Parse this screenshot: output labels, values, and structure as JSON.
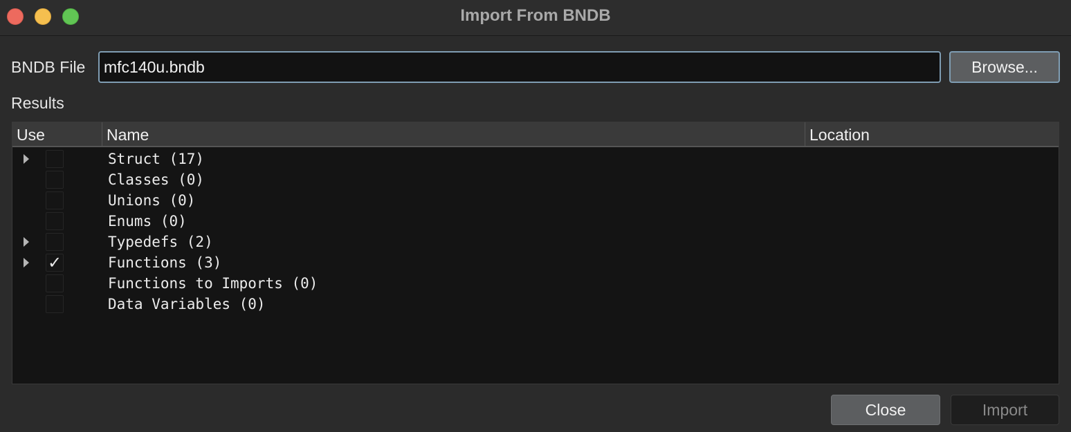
{
  "window": {
    "title": "Import From BNDB"
  },
  "file": {
    "label": "BNDB File",
    "value": "mfc140u.bndb",
    "browse_label": "Browse..."
  },
  "results": {
    "label": "Results",
    "columns": {
      "use": "Use",
      "name": "Name",
      "location": "Location"
    },
    "rows": [
      {
        "name": "Struct (17)",
        "expandable": true,
        "checked": false
      },
      {
        "name": "Classes (0)",
        "expandable": false,
        "checked": false
      },
      {
        "name": "Unions (0)",
        "expandable": false,
        "checked": false
      },
      {
        "name": "Enums (0)",
        "expandable": false,
        "checked": false
      },
      {
        "name": "Typedefs (2)",
        "expandable": true,
        "checked": false
      },
      {
        "name": "Functions (3)",
        "expandable": true,
        "checked": true
      },
      {
        "name": "Functions to Imports (0)",
        "expandable": false,
        "checked": false
      },
      {
        "name": "Data Variables (0)",
        "expandable": false,
        "checked": false
      }
    ]
  },
  "footer": {
    "close_label": "Close",
    "import_label": "Import"
  },
  "colors": {
    "accent_border": "#7f9db3",
    "background": "#2b2b2b",
    "table_background": "#141414"
  }
}
